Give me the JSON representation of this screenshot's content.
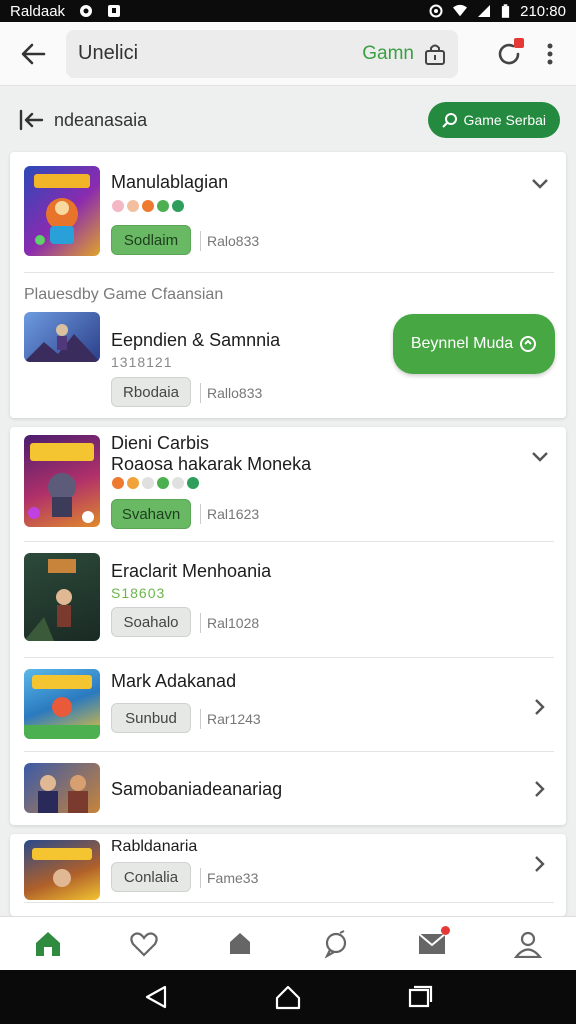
{
  "status_bar": {
    "carrier": "Raldaak",
    "time": "210:80"
  },
  "app_bar": {
    "search_value": "Unelici",
    "search_hint": "Gamn"
  },
  "sub_header": {
    "title": "ndeanasaia",
    "game_search_label": "Game Serbai"
  },
  "card1": {
    "game1": {
      "name": "Manulablagian",
      "status": "Sodlaim",
      "meta": "Ralo833"
    },
    "section_label": "Plauesdby Game Cfaansian",
    "game2": {
      "name": "Eepndien & Samnnia",
      "sub": "1318121",
      "status": "Rbodaia",
      "meta": "Rallo833"
    },
    "action_button": "Beynnel Muda"
  },
  "card2": {
    "game1": {
      "name_line1": "Dieni Carbis",
      "name_line2": "Roaosa hakarak Moneka",
      "status": "Svahavn",
      "meta": "Ral1623"
    },
    "game2": {
      "name": "Eraclarit Menhoania",
      "sub": "S18603",
      "status": "Soahalo",
      "meta": "Ral1028"
    },
    "game3": {
      "name": "Mark Adakanad",
      "status": "Sunbud",
      "meta": "Rar1243"
    },
    "game4": {
      "name": "Samobaniadeanariag"
    }
  },
  "card3": {
    "game1": {
      "name": "Rabldanaria",
      "status": "Conlalia",
      "meta": "Fame33"
    }
  },
  "colors": {
    "accent": "#238a3f",
    "green_button": "#46a743",
    "pill_green": "#69b864"
  },
  "icons": [
    "back-arrow-icon",
    "lock-icon",
    "refresh-icon",
    "more-vert-icon",
    "collapse-arrow-icon",
    "search-icon",
    "chevron-down-icon",
    "chevron-right-icon",
    "home-icon",
    "heart-icon",
    "bell-icon",
    "chat-icon",
    "mail-icon",
    "person-icon"
  ]
}
